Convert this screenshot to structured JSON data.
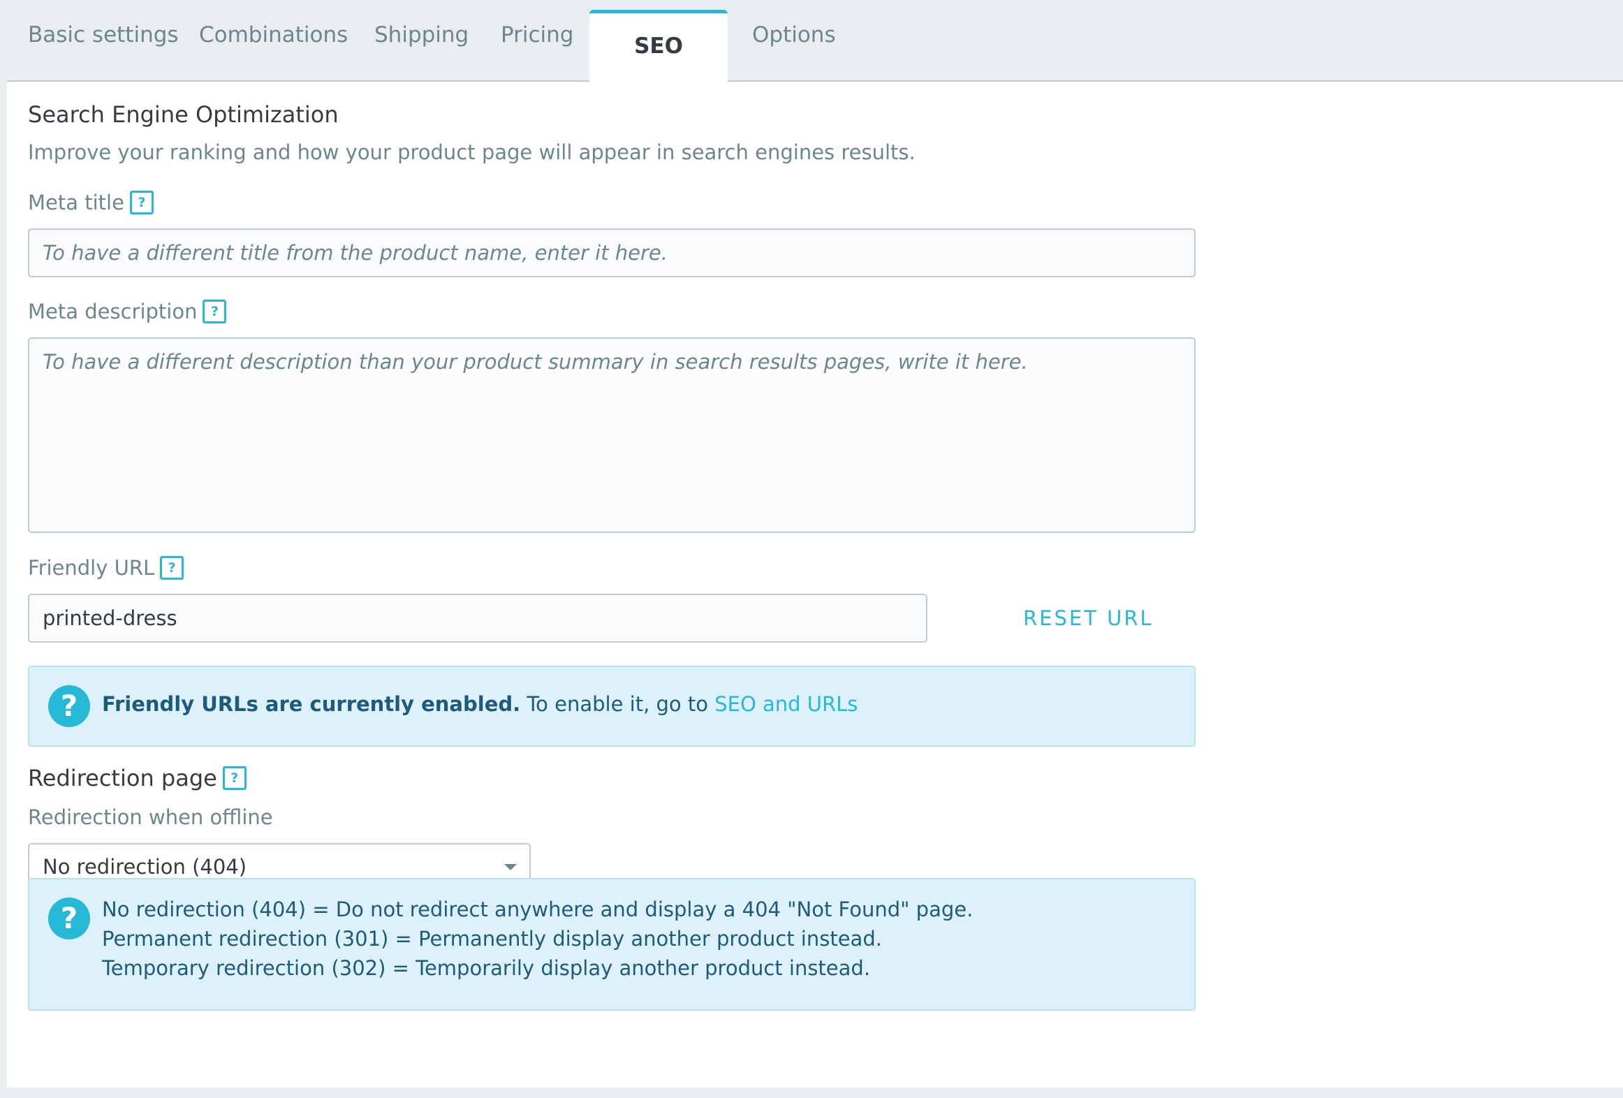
{
  "tabs": [
    {
      "label": "Basic settings"
    },
    {
      "label": "Combinations"
    },
    {
      "label": "Shipping"
    },
    {
      "label": "Pricing"
    },
    {
      "label": "SEO",
      "active": true
    },
    {
      "label": "Options"
    }
  ],
  "seo": {
    "title": "Search Engine Optimization",
    "subtitle": "Improve your ranking and how your product page will appear in search engines results.",
    "help_glyph": "?",
    "meta_title": {
      "label": "Meta title",
      "value": "",
      "placeholder": "To have a different title from the product name, enter it here."
    },
    "meta_description": {
      "label": "Meta description",
      "value": "",
      "placeholder": "To have a different description than your product summary in search results pages, write it here."
    },
    "friendly_url": {
      "label": "Friendly URL",
      "value": "printed-dress",
      "reset_label": "RESET URL"
    },
    "url_alert": {
      "bold": "Friendly URLs are currently enabled.",
      "text": " To enable it, go to ",
      "link": "SEO and URLs"
    },
    "redirection": {
      "heading": "Redirection page",
      "label": "Redirection when offline",
      "selected": "No redirection (404)",
      "info_lines": [
        "No redirection (404) = Do not redirect anywhere and display a 404 \"Not Found\" page.",
        "Permanent redirection (301) = Permanently display another product instead.",
        "Temporary redirection (302) = Temporarily display another product instead."
      ]
    }
  },
  "colors": {
    "accent": "#25b9d7",
    "muted_text": "#6c868e",
    "alert_bg": "#dcf1f9",
    "page_bg": "#eaedef"
  }
}
